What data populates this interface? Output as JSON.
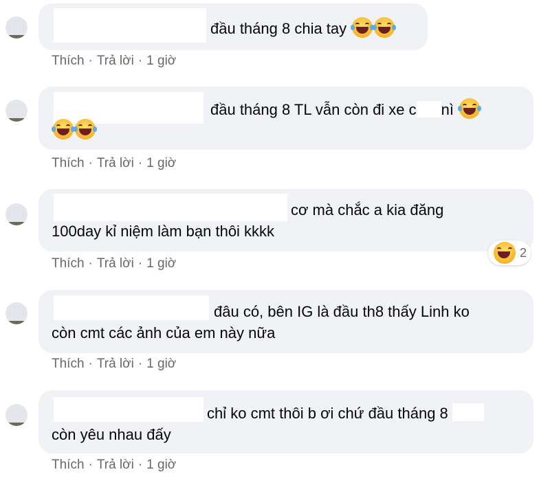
{
  "comments": [
    {
      "text_line1": "đầu tháng 8 chia tay",
      "text_line2": "",
      "emoji_count_inline": 2,
      "actions": {
        "like": "Thích",
        "reply": "Trả lời",
        "time": "1 giờ"
      }
    },
    {
      "text_line1": "đầu tháng 8 TL vẫn còn đi xe c",
      "text_line1_tail": "nì",
      "text_line2": "",
      "actions": {
        "like": "Thích",
        "reply": "Trả lời",
        "time": "1 giờ"
      }
    },
    {
      "text_line1": "cơ mà chắc a kia đăng",
      "text_line2": "100day kỉ niệm làm bạn thôi kkkk",
      "reaction_count": "2",
      "actions": {
        "like": "Thích",
        "reply": "Trả lời",
        "time": "1 giờ"
      }
    },
    {
      "text_line1": "đâu có, bên IG là đầu th8 thấy Linh ko",
      "text_line2": "còn cmt các ảnh của em này nữa",
      "actions": {
        "like": "Thích",
        "reply": "Trả lời",
        "time": "1 giờ"
      }
    },
    {
      "text_line1": "chỉ ko cmt thôi b ơi chứ đầu tháng 8",
      "text_line2": "còn yêu nhau đấy",
      "actions": {
        "like": "Thích",
        "reply": "Trả lời",
        "time": "1 giờ"
      }
    }
  ],
  "separator": "·",
  "emoji_icon": "laughing-tears-emoji-icon",
  "colors": {
    "bubble": "#f0f2f5",
    "text": "#050505",
    "meta": "#65676b"
  }
}
